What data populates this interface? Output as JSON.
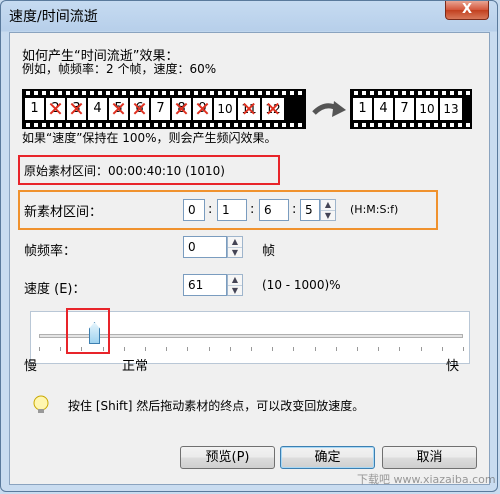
{
  "window": {
    "title": "速度/时间流逝",
    "close_label": "X"
  },
  "intro": {
    "line1": "如何产生“时间流逝”效果：",
    "line2": "例如，帧频率：2 个帧，速度：60%"
  },
  "film_left": {
    "frames": [
      {
        "label": "1",
        "crossed": false
      },
      {
        "label": "2",
        "crossed": true
      },
      {
        "label": "3",
        "crossed": true
      },
      {
        "label": "4",
        "crossed": false
      },
      {
        "label": "5",
        "crossed": true
      },
      {
        "label": "6",
        "crossed": true
      },
      {
        "label": "7",
        "crossed": false
      },
      {
        "label": "8",
        "crossed": true
      },
      {
        "label": "9",
        "crossed": true
      },
      {
        "label": "10",
        "crossed": false
      },
      {
        "label": "11",
        "crossed": true
      },
      {
        "label": "12",
        "crossed": true
      }
    ]
  },
  "film_right": {
    "frames": [
      "1",
      "4",
      "7",
      "10",
      "13"
    ]
  },
  "flicker_note": "如果“速度”保持在 100%，则会产生频闪效果。",
  "original_range": {
    "label": "原始素材区间：",
    "value": "00:00:40:10 (1010)"
  },
  "new_range": {
    "label": "新素材区间：",
    "h": "0",
    "m": "1",
    "s": "6",
    "f": "5",
    "sep": ":",
    "format": "(H:M:S:f)"
  },
  "frame_rate": {
    "label": "帧频率：",
    "value": "0",
    "unit": "帧"
  },
  "speed": {
    "label": "速度 (E)：",
    "value": "61",
    "range": "(10 - 1000)%"
  },
  "slider": {
    "slow": "慢",
    "normal": "正常",
    "fast": "快",
    "position_fraction": 0.055
  },
  "hint": "按住 [Shift] 然后拖动素材的终点，可以改变回放速度。",
  "buttons": {
    "preview": "预览(P)",
    "ok": "确定",
    "cancel": "取消"
  },
  "colors": {
    "highlight_red": "#e8242a",
    "highlight_orange": "#f0922e"
  },
  "watermark": "下载吧 www.xiazaiba.com"
}
